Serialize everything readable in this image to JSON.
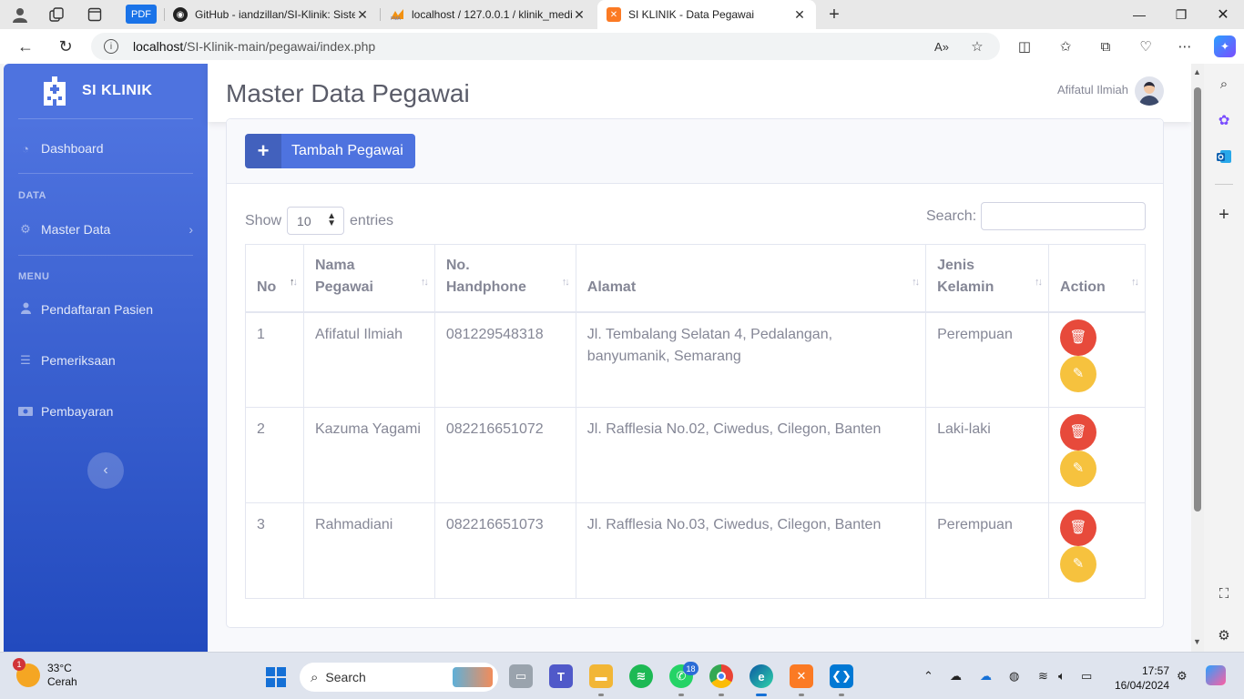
{
  "browser": {
    "tabs": [
      {
        "title": "GitHub - iandzillan/SI-Klinik: Sistem",
        "favicon": "github-icon"
      },
      {
        "title": "localhost / 127.0.0.1 / klinik_medi",
        "favicon": "phpmyadmin-icon"
      },
      {
        "title": "SI KLINIK - Data Pegawai",
        "favicon": "xampp-icon",
        "active": true
      }
    ],
    "pdf_label": "PDF",
    "url_host": "localhost",
    "url_path": "/SI-Klinik-main/pegawai/index.php"
  },
  "sidebar": {
    "brand": "SI KLINIK",
    "dashboard": "Dashboard",
    "heading_data": "DATA",
    "master_data": "Master Data",
    "heading_menu": "MENU",
    "items": [
      "Pendaftaran Pasien",
      "Pemeriksaan",
      "Pembayaran"
    ]
  },
  "topbar": {
    "user_name": "Afifatul Ilmiah"
  },
  "page": {
    "title": "Master Data Pegawai",
    "add_button": "Tambah Pegawai",
    "show_label": "Show",
    "entries_value": "10",
    "entries_label": "entries",
    "search_label": "Search:"
  },
  "table": {
    "headers": [
      {
        "line1": "No",
        "line2": ""
      },
      {
        "line1": "Nama",
        "line2": "Pegawai"
      },
      {
        "line1": "No.",
        "line2": "Handphone"
      },
      {
        "line1": "Alamat",
        "line2": ""
      },
      {
        "line1": "Jenis",
        "line2": "Kelamin"
      },
      {
        "line1": "Action",
        "line2": ""
      }
    ],
    "rows": [
      {
        "no": "1",
        "nama": "Afifatul Ilmiah",
        "hp": "081229548318",
        "alamat": "Jl. Tembalang Selatan 4, Pedalangan, banyumanik, Semarang",
        "jk": "Perempuan"
      },
      {
        "no": "2",
        "nama": "Kazuma Yagami",
        "hp": "082216651072",
        "alamat": "Jl. Rafflesia No.02, Ciwedus, Cilegon, Banten",
        "jk": "Laki-laki"
      },
      {
        "no": "3",
        "nama": "Rahmadiani",
        "hp": "082216651073",
        "alamat": "Jl. Rafflesia No.03, Ciwedus, Cilegon, Banten",
        "jk": "Perempuan"
      }
    ]
  },
  "taskbar": {
    "temperature": "33°C",
    "weather": "Cerah",
    "weather_badge": "1",
    "search": "Search",
    "whatsapp_badge": "18",
    "time": "17:57",
    "date": "16/04/2024"
  },
  "colors": {
    "primary": "#4e73df",
    "danger": "#e74a3b",
    "warning": "#f6c23e"
  }
}
